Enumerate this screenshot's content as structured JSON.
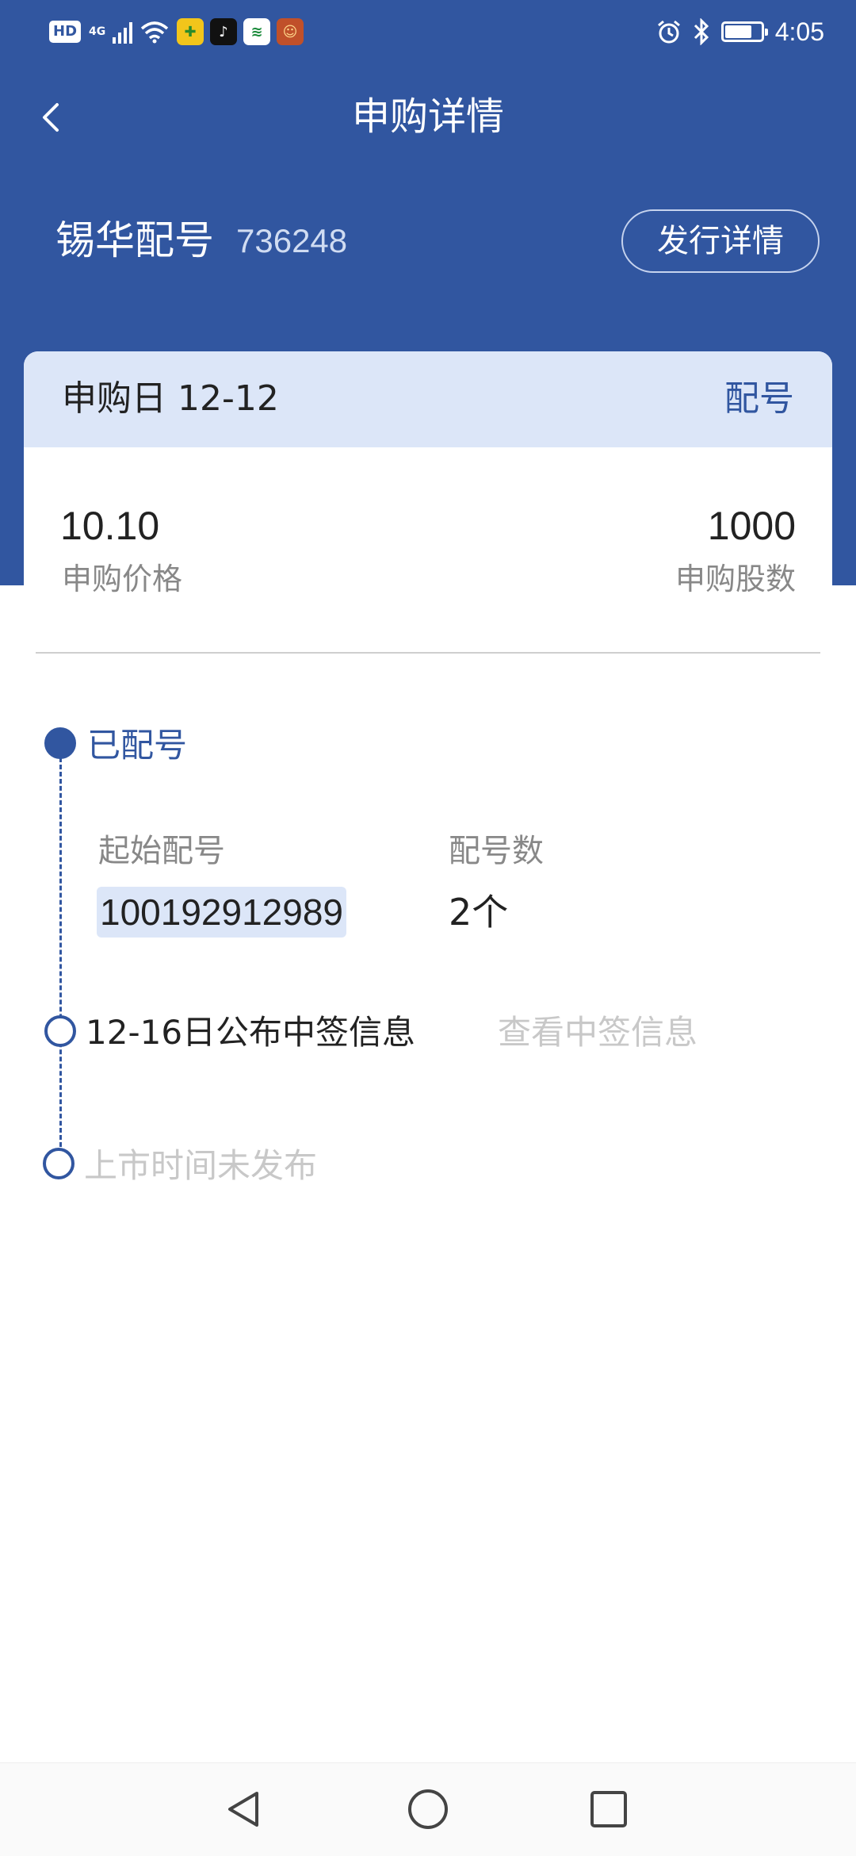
{
  "status_bar": {
    "hd": "HD",
    "network": "4G",
    "time": "4:05",
    "battery_level": 0.75,
    "apps": [
      {
        "name": "game-app-icon",
        "glyph": "✚",
        "bg": "#f2c51b",
        "fg": "#2a8a2a"
      },
      {
        "name": "tiktok-icon",
        "glyph": "♪",
        "bg": "#111111",
        "fg": "#ffffff"
      },
      {
        "name": "post-app-icon",
        "glyph": "≋",
        "bg": "#ffffff",
        "fg": "#1a8a3a"
      },
      {
        "name": "avatar-app-icon",
        "glyph": "☺",
        "bg": "#c0502a",
        "fg": "#ffd88a"
      }
    ]
  },
  "header": {
    "title": "申购详情",
    "stock_name": "锡华配号",
    "stock_code": "736248",
    "issue_detail_button": "发行详情"
  },
  "card": {
    "subscribe_date": "申购日 12-12",
    "status": "配号",
    "price_value": "10.10",
    "price_label": "申购价格",
    "shares_value": "1000",
    "shares_label": "申购股数"
  },
  "timeline": {
    "step1": "已配号",
    "start_number_label": "起始配号",
    "start_number_value": "100192912989",
    "number_count_label": "配号数",
    "number_count_value": "2个",
    "step2": "12-16日公布中签信息",
    "view_lottery_link": "查看中签信息",
    "step3": "上市时间未发布"
  },
  "colors": {
    "primary": "#3156a0",
    "card_header": "#dce6f8",
    "muted": "#888888",
    "disabled": "#c8c8c8"
  }
}
